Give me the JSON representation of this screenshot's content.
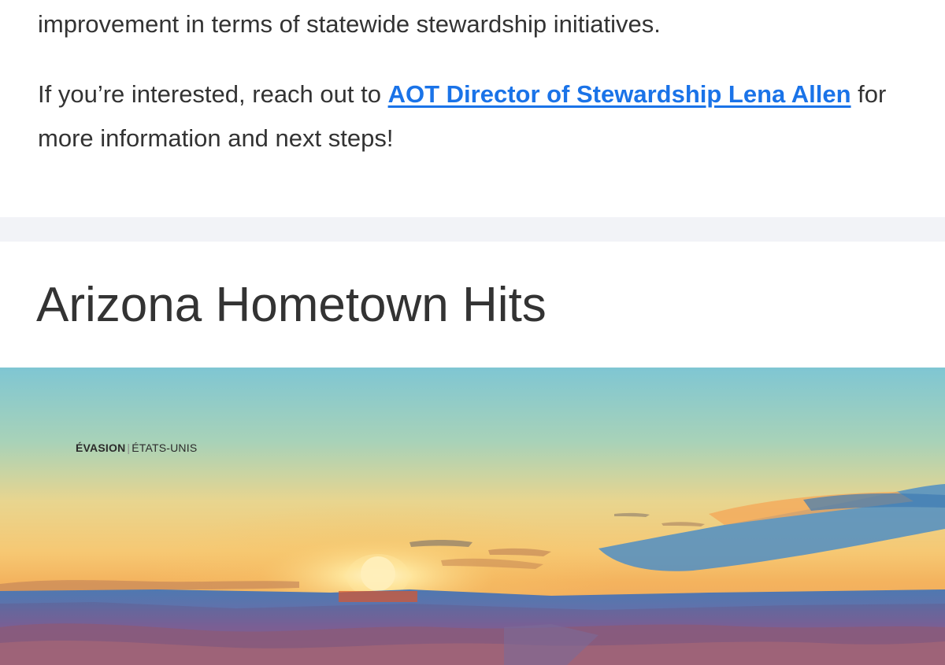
{
  "stewardship": {
    "line1": "improvement in terms of statewide stewardship initiatives.",
    "para2_before": "If you’re interested, reach out to ",
    "link_text": "AOT Director of Stewardship Lena Allen",
    "para2_after": " for more information and next steps!"
  },
  "section": {
    "title": "Arizona Hometown Hits"
  },
  "hero": {
    "label_strong": "ÉVASION",
    "label_sep": "|",
    "label_rest": "ÉTATS-UNIS"
  },
  "colors": {
    "link": "#1a73e8",
    "text": "#333333",
    "divider": "#f2f3f7"
  }
}
